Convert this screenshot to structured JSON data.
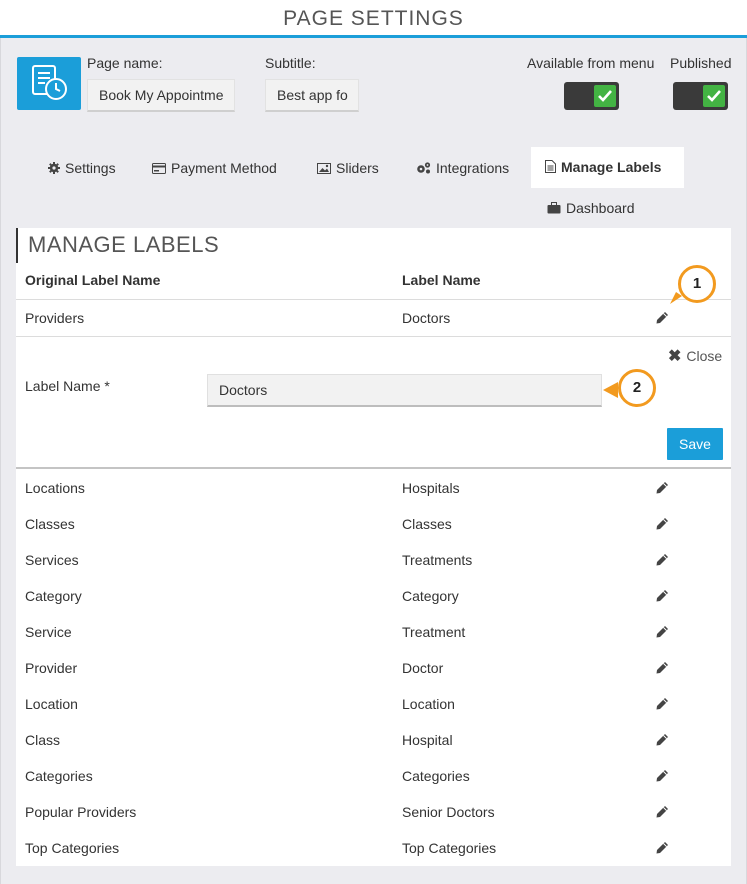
{
  "header": {
    "title": "PAGE SETTINGS"
  },
  "page_name": {
    "label": "Page name:",
    "value": "Book My Appointme"
  },
  "subtitle": {
    "label": "Subtitle:",
    "value": "Best app fo"
  },
  "toggles": {
    "available_label": "Available from menu",
    "published_label": "Published"
  },
  "tabs": [
    {
      "label": "Settings",
      "icon": "gear-icon"
    },
    {
      "label": "Payment Method",
      "icon": "credit-card-icon"
    },
    {
      "label": "Sliders",
      "icon": "image-icon"
    },
    {
      "label": "Integrations",
      "icon": "gears-icon"
    },
    {
      "label": "Manage Labels",
      "icon": "file-text-icon",
      "active": true
    },
    {
      "label": "Dashboard",
      "icon": "briefcase-icon"
    }
  ],
  "panel": {
    "title": "MANAGE LABELS",
    "col_original": "Original Label Name",
    "col_label": "Label Name"
  },
  "editing_row": {
    "original": "Providers",
    "label": "Doctors"
  },
  "edit_form": {
    "field_label": "Label Name *",
    "field_value": "Doctors",
    "close_label": "Close",
    "save_label": "Save"
  },
  "rows": [
    {
      "original": "Locations",
      "label": "Hospitals"
    },
    {
      "original": "Classes",
      "label": "Classes"
    },
    {
      "original": "Services",
      "label": "Treatments"
    },
    {
      "original": "Category",
      "label": "Category"
    },
    {
      "original": "Service",
      "label": "Treatment"
    },
    {
      "original": "Provider",
      "label": "Doctor"
    },
    {
      "original": "Location",
      "label": "Location"
    },
    {
      "original": "Class",
      "label": "Hospital"
    },
    {
      "original": "Categories",
      "label": "Categories"
    },
    {
      "original": "Popular Providers",
      "label": "Senior Doctors"
    },
    {
      "original": "Top Categories",
      "label": "Top Categories"
    }
  ],
  "callouts": {
    "one": "1",
    "two": "2"
  },
  "colors": {
    "accent": "#1b9ed9",
    "toggle_on": "#43b343",
    "callout": "#f29a1f"
  }
}
